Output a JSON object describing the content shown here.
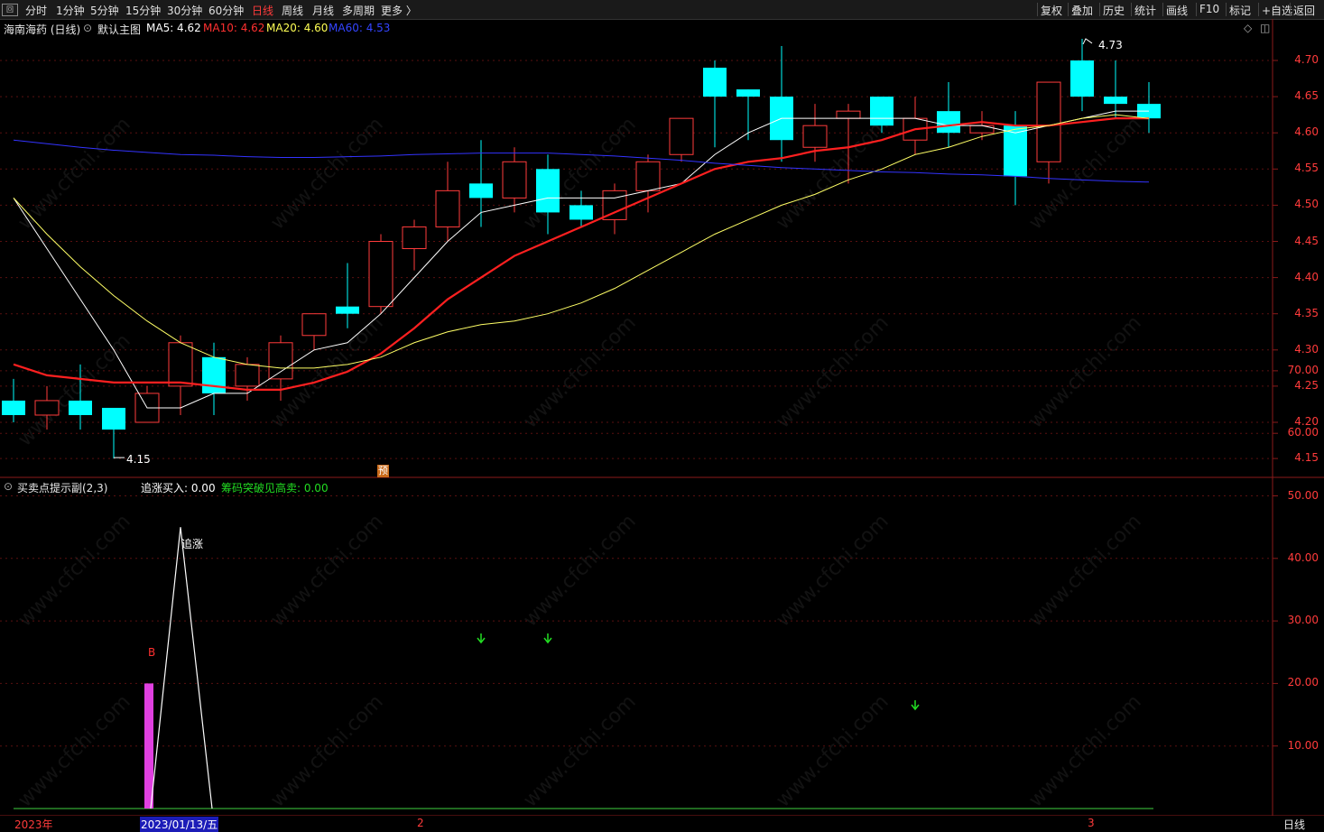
{
  "toolbar": {
    "logo": "回",
    "periods": [
      "分时",
      "1分钟",
      "5分钟",
      "15分钟",
      "30分钟",
      "60分钟",
      "日线",
      "周线",
      "月线",
      "多周期",
      "更多 〉"
    ],
    "active_period": "日线",
    "right_buttons": [
      "复权",
      "叠加",
      "历史",
      "统计",
      "画线",
      "F10",
      "标记",
      "+自选",
      "返回"
    ]
  },
  "main_header": {
    "stock": "海南海药 (日线)",
    "template": "默认主图",
    "ma5": "MA5: 4.62",
    "ma10": "MA10: 4.62",
    "ma20": "MA20: 4.60",
    "ma60": "MA60: 4.53"
  },
  "sub_header": {
    "name": "买卖点提示副(2,3)",
    "v1": "追涨买入: 0.00",
    "v2": "筹码突破见高卖: 0.00"
  },
  "annotations": {
    "high": "4.73",
    "low": "4.15",
    "pre": "预",
    "chase": "追涨",
    "buy": "B"
  },
  "price_axis": [
    "4.70",
    "4.65",
    "4.60",
    "4.55",
    "4.50",
    "4.45",
    "4.40",
    "4.35",
    "4.30",
    "4.25",
    "4.20",
    "4.15"
  ],
  "sub_axis": [
    "70.00",
    "60.00",
    "50.00",
    "40.00",
    "30.00",
    "20.00",
    "10.00"
  ],
  "bottom_bar": {
    "year": "2023年",
    "cursor_date": "2023/01/13/五",
    "month2": "2",
    "month3": "3",
    "period": "日线"
  },
  "watermark": "www.cfchi.com",
  "colors": {
    "up": "#ff3b3b",
    "down": "#00ffff",
    "ma5": "#ffffff",
    "ma10": "#ff2020",
    "ma20": "#ffff66",
    "ma60": "#3333ff"
  },
  "chart_data": [
    {
      "type": "candlestick",
      "title": "海南海药 (日线)",
      "ylim": [
        4.13,
        4.75
      ],
      "candles": [
        {
          "o": 4.23,
          "c": 4.21,
          "h": 4.26,
          "l": 4.2
        },
        {
          "o": 4.21,
          "c": 4.23,
          "h": 4.25,
          "l": 4.19
        },
        {
          "o": 4.23,
          "c": 4.21,
          "h": 4.28,
          "l": 4.19
        },
        {
          "o": 4.22,
          "c": 4.19,
          "h": 4.22,
          "l": 4.15
        },
        {
          "o": 4.2,
          "c": 4.24,
          "h": 4.25,
          "l": 4.2
        },
        {
          "o": 4.25,
          "c": 4.31,
          "h": 4.32,
          "l": 4.21
        },
        {
          "o": 4.29,
          "c": 4.24,
          "h": 4.31,
          "l": 4.21
        },
        {
          "o": 4.25,
          "c": 4.28,
          "h": 4.29,
          "l": 4.23
        },
        {
          "o": 4.26,
          "c": 4.31,
          "h": 4.32,
          "l": 4.23
        },
        {
          "o": 4.32,
          "c": 4.35,
          "h": 4.35,
          "l": 4.3
        },
        {
          "o": 4.36,
          "c": 4.35,
          "h": 4.42,
          "l": 4.33
        },
        {
          "o": 4.36,
          "c": 4.45,
          "h": 4.46,
          "l": 4.35
        },
        {
          "o": 4.44,
          "c": 4.47,
          "h": 4.48,
          "l": 4.41
        },
        {
          "o": 4.47,
          "c": 4.52,
          "h": 4.56,
          "l": 4.45
        },
        {
          "o": 4.53,
          "c": 4.51,
          "h": 4.59,
          "l": 4.47
        },
        {
          "o": 4.51,
          "c": 4.56,
          "h": 4.58,
          "l": 4.49
        },
        {
          "o": 4.55,
          "c": 4.49,
          "h": 4.57,
          "l": 4.46
        },
        {
          "o": 4.5,
          "c": 4.48,
          "h": 4.52,
          "l": 4.47
        },
        {
          "o": 4.48,
          "c": 4.52,
          "h": 4.53,
          "l": 4.46
        },
        {
          "o": 4.52,
          "c": 4.56,
          "h": 4.57,
          "l": 4.49
        },
        {
          "o": 4.57,
          "c": 4.62,
          "h": 4.62,
          "l": 4.56
        },
        {
          "o": 4.69,
          "c": 4.65,
          "h": 4.7,
          "l": 4.58
        },
        {
          "o": 4.66,
          "c": 4.65,
          "h": 4.66,
          "l": 4.59
        },
        {
          "o": 4.65,
          "c": 4.59,
          "h": 4.72,
          "l": 4.56
        },
        {
          "o": 4.58,
          "c": 4.61,
          "h": 4.64,
          "l": 4.56
        },
        {
          "o": 4.62,
          "c": 4.63,
          "h": 4.64,
          "l": 4.53
        },
        {
          "o": 4.65,
          "c": 4.61,
          "h": 4.65,
          "l": 4.6
        },
        {
          "o": 4.59,
          "c": 4.62,
          "h": 4.65,
          "l": 4.57
        },
        {
          "o": 4.63,
          "c": 4.6,
          "h": 4.67,
          "l": 4.58
        },
        {
          "o": 4.6,
          "c": 4.61,
          "h": 4.63,
          "l": 4.59
        },
        {
          "o": 4.61,
          "c": 4.54,
          "h": 4.63,
          "l": 4.5
        },
        {
          "o": 4.56,
          "c": 4.67,
          "h": 4.67,
          "l": 4.53
        },
        {
          "o": 4.7,
          "c": 4.65,
          "h": 4.73,
          "l": 4.63
        },
        {
          "o": 4.65,
          "c": 4.64,
          "h": 4.7,
          "l": 4.62
        },
        {
          "o": 4.64,
          "c": 4.62,
          "h": 4.67,
          "l": 4.6
        }
      ],
      "series": [
        {
          "name": "MA5",
          "values": [
            4.51,
            4.44,
            4.37,
            4.3,
            4.22,
            4.22,
            4.24,
            4.24,
            4.27,
            4.3,
            4.31,
            4.35,
            4.4,
            4.45,
            4.49,
            4.5,
            4.51,
            4.51,
            4.51,
            4.52,
            4.53,
            4.57,
            4.6,
            4.62,
            4.62,
            4.62,
            4.62,
            4.62,
            4.61,
            4.61,
            4.6,
            4.61,
            4.62,
            4.63,
            4.63
          ]
        },
        {
          "name": "MA10",
          "values": [
            4.28,
            4.265,
            4.26,
            4.255,
            4.255,
            4.255,
            4.25,
            4.245,
            4.245,
            4.255,
            4.27,
            4.295,
            4.33,
            4.37,
            4.4,
            4.43,
            4.45,
            4.47,
            4.49,
            4.51,
            4.53,
            4.55,
            4.56,
            4.565,
            4.575,
            4.58,
            4.59,
            4.605,
            4.61,
            4.615,
            4.61,
            4.61,
            4.615,
            4.62,
            4.62
          ]
        },
        {
          "name": "MA20",
          "values": [
            4.51,
            4.46,
            4.415,
            4.375,
            4.34,
            4.31,
            4.29,
            4.28,
            4.275,
            4.275,
            4.28,
            4.29,
            4.31,
            4.325,
            4.335,
            4.34,
            4.35,
            4.365,
            4.385,
            4.41,
            4.435,
            4.46,
            4.48,
            4.5,
            4.515,
            4.535,
            4.55,
            4.57,
            4.58,
            4.595,
            4.605,
            4.61,
            4.62,
            4.625,
            4.62
          ]
        },
        {
          "name": "MA60",
          "values": [
            4.59,
            4.585,
            4.58,
            4.576,
            4.573,
            4.57,
            4.569,
            4.567,
            4.566,
            4.566,
            4.567,
            4.568,
            4.57,
            4.571,
            4.572,
            4.572,
            4.572,
            4.57,
            4.568,
            4.565,
            4.562,
            4.558,
            4.555,
            4.552,
            4.55,
            4.548,
            4.546,
            4.545,
            4.543,
            4.542,
            4.54,
            4.537,
            4.535,
            4.533,
            4.532
          ]
        }
      ]
    },
    {
      "type": "line",
      "title": "买卖点提示副(2,3)",
      "ylim": [
        0,
        75
      ],
      "series": [
        {
          "name": "追涨",
          "values": [
            0,
            0,
            0,
            0,
            0,
            45,
            0,
            0,
            0,
            0,
            0,
            0,
            0,
            0,
            0,
            0,
            0,
            0,
            0,
            0,
            0,
            0,
            0,
            0,
            0,
            0,
            0,
            0,
            0,
            0,
            0,
            0,
            0,
            0,
            0
          ]
        }
      ],
      "bars": [
        {
          "index": 4,
          "value": 20
        }
      ],
      "sell_arrows": [
        14,
        16,
        27
      ],
      "buy_marks": [
        {
          "index": 4,
          "label": "B"
        }
      ]
    }
  ]
}
